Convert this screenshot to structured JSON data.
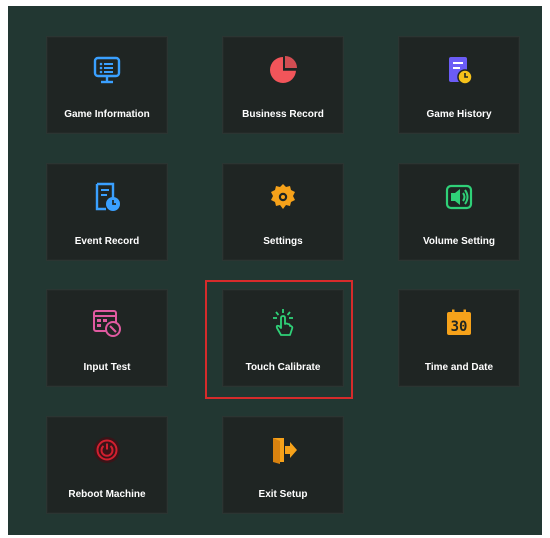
{
  "menu": {
    "tiles": [
      {
        "label": "Game Information",
        "icon": "monitor-list-icon"
      },
      {
        "label": "Business Record",
        "icon": "pie-chart-icon"
      },
      {
        "label": "Game History",
        "icon": "document-clock-icon"
      },
      {
        "label": "Event Record",
        "icon": "receipt-clock-icon"
      },
      {
        "label": "Settings",
        "icon": "gear-icon"
      },
      {
        "label": "Volume Setting",
        "icon": "speaker-icon"
      },
      {
        "label": "Input Test",
        "icon": "keypad-wrench-icon"
      },
      {
        "label": "Touch Calibrate",
        "icon": "tap-hand-icon"
      },
      {
        "label": "Time and Date",
        "icon": "calendar-icon"
      },
      {
        "label": "Reboot Machine",
        "icon": "power-icon"
      },
      {
        "label": "Exit Setup",
        "icon": "exit-door-icon"
      }
    ],
    "selected": "Touch Calibrate",
    "calendar_day": "30"
  },
  "colors": {
    "background": "#223732",
    "tile": "#1f2523",
    "selection": "#d62b2b",
    "blue_icon": "#3aa0ff",
    "red_icon": "#f2555a",
    "purple_icon": "#6b5cf6",
    "orange_icon": "#f6a21a",
    "green_icon": "#2fd178",
    "pink_icon": "#e05aa0",
    "power_icon": "#d21f2f"
  }
}
